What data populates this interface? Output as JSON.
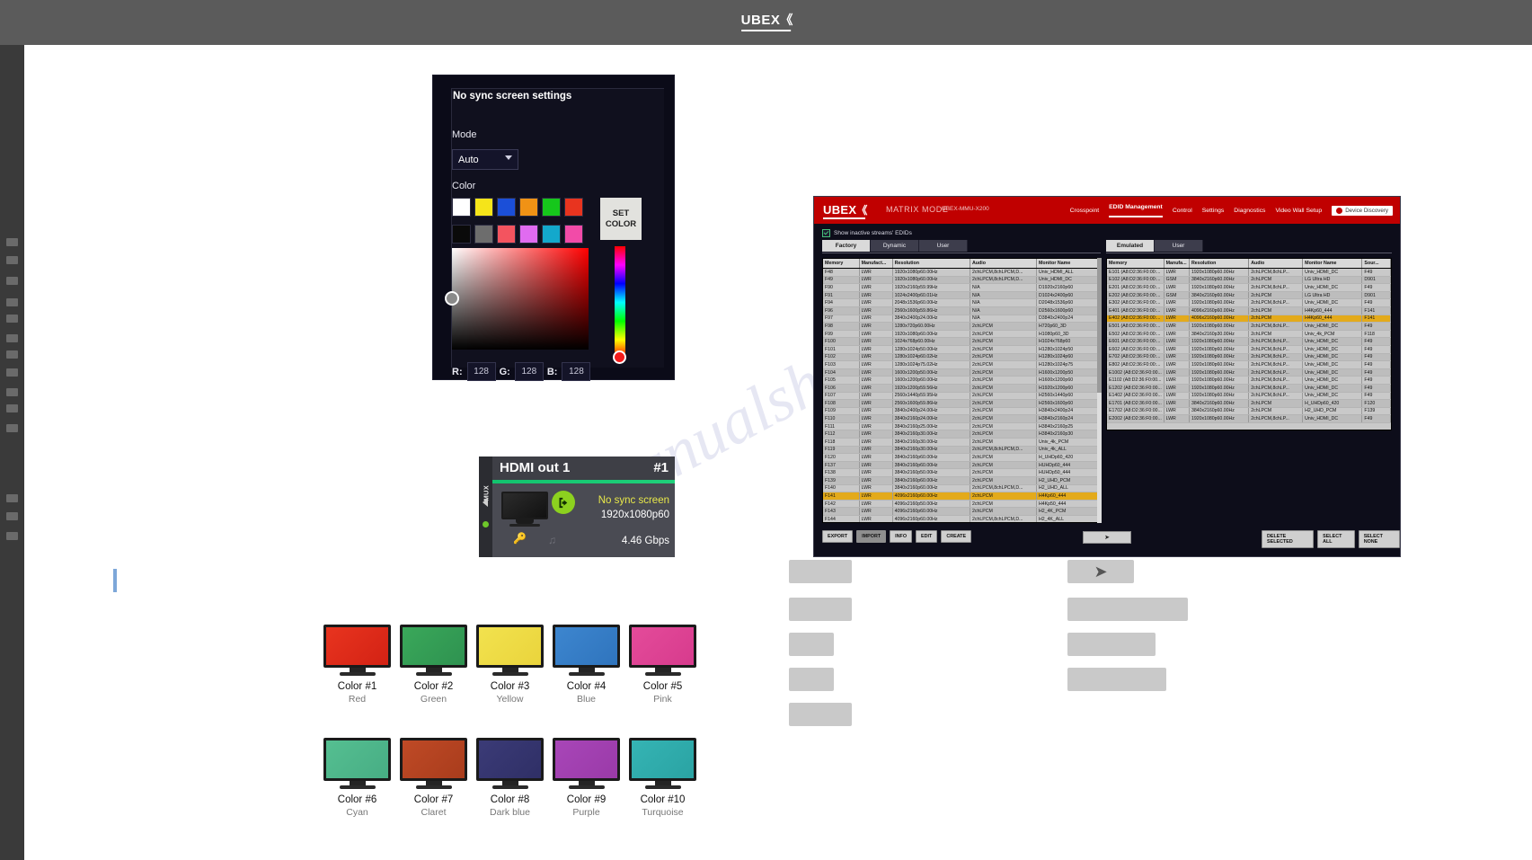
{
  "window": {
    "app_name": "UBEX",
    "logo_mark": "《"
  },
  "no_sync_dialog": {
    "title": "No sync screen settings",
    "mode_label": "Mode",
    "mode_value": "Auto",
    "color_label": "Color",
    "set_color_button": "SET COLOR",
    "swatches_row1": [
      "#ffffff",
      "#f5e41a",
      "#1b4fd8",
      "#f09215",
      "#16c71b",
      "#e8341f"
    ],
    "swatches_row2": [
      "#0a0a0a",
      "#6d6d6d",
      "#f3545f",
      "#e06bf0",
      "#13a8cc",
      "#f24ba8"
    ],
    "rgb": {
      "r_label": "R:",
      "r_value": "128",
      "g_label": "G:",
      "g_value": "128",
      "b_label": "B:",
      "b_value": "128"
    }
  },
  "hdmi_card": {
    "mux_label": "MUX",
    "title": "HDMI out 1",
    "number": "#1",
    "status": "No sync screen",
    "resolution": "1920x1080p60",
    "bitrate": "4.46 Gbps",
    "key_icon": "key-icon",
    "note_icon": "music-note-icon"
  },
  "color_monitors": [
    {
      "name": "Color #1",
      "label": "Red",
      "color": "#e8341f",
      "color2": "#d32214"
    },
    {
      "name": "Color #2",
      "label": "Green",
      "color": "#3aa85a",
      "color2": "#2e9250"
    },
    {
      "name": "Color #3",
      "label": "Yellow",
      "color": "#f2e24e",
      "color2": "#ead43c"
    },
    {
      "name": "Color #4",
      "label": "Blue",
      "color": "#3d86cf",
      "color2": "#2f74bd"
    },
    {
      "name": "Color #5",
      "label": "Pink",
      "color": "#e44b9a",
      "color2": "#d73b8d"
    },
    {
      "name": "Color #6",
      "label": "Cyan",
      "color": "#55bf91",
      "color2": "#47ad84"
    },
    {
      "name": "Color #7",
      "label": "Claret",
      "color": "#bf4a26",
      "color2": "#a93c1c"
    },
    {
      "name": "Color #8",
      "label": "Dark blue",
      "color": "#3b3b77",
      "color2": "#2f2f66"
    },
    {
      "name": "Color #9",
      "label": "Purple",
      "color": "#a846b8",
      "color2": "#9a3aa8"
    },
    {
      "name": "Color #10",
      "label": "Turquoise",
      "color": "#35b4b4",
      "color2": "#2aa3a3"
    }
  ],
  "ubex_app": {
    "brand": "UBEX",
    "mode": "MATRIX MODE",
    "device": "UBEX-MMU-X200",
    "nav": [
      "Crosspoint",
      "EDID Management",
      "Control",
      "Settings",
      "Diagnostics",
      "Video Wall Setup"
    ],
    "nav_active": "EDID Management",
    "device_discovery_button": "Device Discovery",
    "show_inactive_label": "Show inactive streams' EDIDs",
    "left_tabs": [
      "Factory",
      "Dynamic",
      "User"
    ],
    "left_tab_active": "Factory",
    "right_tabs": [
      "Emulated",
      "User"
    ],
    "right_tab_active": "Emulated",
    "left_columns": [
      "Memory",
      "Manufact...",
      "Resolution",
      "Audio",
      "Monitor Name"
    ],
    "right_columns": [
      "Memory",
      "Manufa...",
      "Resolution",
      "Audio",
      "Monitor Name",
      "Sour..."
    ],
    "left_rows": [
      [
        "F48",
        "LWR",
        "1920x1080p60.00Hz",
        "2chLPCM,8chLPCM,D...",
        "Univ_HDMI_ALL"
      ],
      [
        "F49",
        "LWR",
        "1920x1080p60.00Hz",
        "2chLPCM,8chLPCM,D...",
        "Univ_HDMI_DC"
      ],
      [
        "F90",
        "LWR",
        "1920x2160p59.99Hz",
        "N/A",
        "D1920x2160p60"
      ],
      [
        "F91",
        "LWR",
        "1024x2400p60.01Hz",
        "N/A",
        "D1024x2400p60"
      ],
      [
        "F94",
        "LWR",
        "2048x1536p60.00Hz",
        "N/A",
        "D2048x1536p60"
      ],
      [
        "F96",
        "LWR",
        "2560x1600p59.86Hz",
        "N/A",
        "D2560x1600p60"
      ],
      [
        "F97",
        "LWR",
        "3840x2400p24.00Hz",
        "N/A",
        "D3840x2400p24"
      ],
      [
        "F98",
        "LWR",
        "1280x720p60.00Hz",
        "2chLPCM",
        "H720p60_3D"
      ],
      [
        "F99",
        "LWR",
        "1920x1080p60.00Hz",
        "2chLPCM",
        "H1080p60_3D"
      ],
      [
        "F100",
        "LWR",
        "1024x768p60.00Hz",
        "2chLPCM",
        "H1024x768p60"
      ],
      [
        "F101",
        "LWR",
        "1280x1024p50.00Hz",
        "2chLPCM",
        "H1280x1024p50"
      ],
      [
        "F102",
        "LWR",
        "1280x1024p60.02Hz",
        "2chLPCM",
        "H1280x1024p60"
      ],
      [
        "F103",
        "LWR",
        "1280x1024p75.02Hz",
        "2chLPCM",
        "H1280x1024p75"
      ],
      [
        "F104",
        "LWR",
        "1600x1200p50.00Hz",
        "2chLPCM",
        "H1600x1200p50"
      ],
      [
        "F105",
        "LWR",
        "1600x1200p60.00Hz",
        "2chLPCM",
        "H1600x1200p60"
      ],
      [
        "F106",
        "LWR",
        "1920x1200p59.56Hz",
        "2chLPCM",
        "H1920x1200p60"
      ],
      [
        "F107",
        "LWR",
        "2560x1440p59.95Hz",
        "2chLPCM",
        "H2560x1440p60"
      ],
      [
        "F108",
        "LWR",
        "2560x1600p59.86Hz",
        "2chLPCM",
        "H2560x1600p60"
      ],
      [
        "F109",
        "LWR",
        "3840x2400p24.00Hz",
        "2chLPCM",
        "H3840x2400p24"
      ],
      [
        "F110",
        "LWR",
        "3840x2160p24.00Hz",
        "2chLPCM",
        "H3840x2160p24"
      ],
      [
        "F111",
        "LWR",
        "3840x2160p25.00Hz",
        "2chLPCM",
        "H3840x2160p25"
      ],
      [
        "F112",
        "LWR",
        "3840x2160p30.00Hz",
        "2chLPCM",
        "H3840x2160p30"
      ],
      [
        "F118",
        "LWR",
        "3840x2160p30.00Hz",
        "2chLPCM",
        "Univ_4k_PCM"
      ],
      [
        "F119",
        "LWR",
        "3840x2160p30.00Hz",
        "2chLPCM,8chLPCM,D...",
        "Univ_4k_ALL"
      ],
      [
        "F120",
        "LWR",
        "3840x2160p60.00Hz",
        "2chLPCM",
        "H_UHDp60_420"
      ],
      [
        "F137",
        "LWR",
        "3840x2160p60.00Hz",
        "2chLPCM",
        "HUHDp60_444"
      ],
      [
        "F138",
        "LWR",
        "3840x2160p50.00Hz",
        "2chLPCM",
        "HUHDp50_444"
      ],
      [
        "F139",
        "LWR",
        "3840x2160p60.00Hz",
        "2chLPCM",
        "H2_UHD_PCM"
      ],
      [
        "F140",
        "LWR",
        "3840x2160p60.00Hz",
        "2chLPCM,8chLPCM,D...",
        "H2_UHD_ALL"
      ],
      [
        "F141",
        "LWR",
        "4096x2160p60.00Hz",
        "2chLPCM",
        "H4Kp60_444"
      ],
      [
        "F142",
        "LWR",
        "4096x2160p50.00Hz",
        "2chLPCM",
        "H4Kp50_444"
      ],
      [
        "F143",
        "LWR",
        "4096x2160p60.00Hz",
        "2chLPCM",
        "H2_4K_PCM"
      ],
      [
        "F144",
        "LWR",
        "4096x2160p60.00Hz",
        "2chLPCM,8chLPCM,D...",
        "H2_4K_ALL"
      ]
    ],
    "left_highlight_row": "F141",
    "right_rows": [
      [
        "E101 (A8:D2:36:F0:00:...",
        "LWR",
        "1920x1080p60.00Hz",
        "2chLPCM,8chLP...",
        "Univ_HDMI_DC",
        "F49"
      ],
      [
        "E102 (A8:D2:36:F0:00:...",
        "GSM",
        "3840x2160p60.00Hz",
        "2chLPCM",
        "LG Ultra HD",
        "D901"
      ],
      [
        "E201 (A8:D2:36:F0:00:...",
        "LWR",
        "1920x1080p60.00Hz",
        "2chLPCM,8chLP...",
        "Univ_HDMI_DC",
        "F49"
      ],
      [
        "E202 (A8:D2:36:F0:00:...",
        "GSM",
        "3840x2160p60.00Hz",
        "2chLPCM",
        "LG Ultra HD",
        "D901"
      ],
      [
        "E302 (A8:D2:36:F0:00:...",
        "LWR",
        "1920x1080p60.00Hz",
        "2chLPCM,8chLP...",
        "Univ_HDMI_DC",
        "F49"
      ],
      [
        "E401 (A8:D2:36:F0:00:...",
        "LWR",
        "4096x2160p60.00Hz",
        "2chLPCM",
        "H4Kp60_444",
        "F141"
      ],
      [
        "E402 (A8:D2:36:F0:00:...",
        "LWR",
        "4096x2160p60.00Hz",
        "2chLPCM",
        "H4Kp60_444",
        "F141"
      ],
      [
        "E501 (A8:D2:36:F0:00:...",
        "LWR",
        "1920x1080p60.00Hz",
        "2chLPCM,8chLP...",
        "Univ_HDMI_DC",
        "F49"
      ],
      [
        "E502 (A8:D2:36:F0:00:...",
        "LWR",
        "3840x2160p30.00Hz",
        "2chLPCM",
        "Univ_4k_PCM",
        "F118"
      ],
      [
        "E601 (A8:D2:36:F0:00:...",
        "LWR",
        "1920x1080p60.00Hz",
        "2chLPCM,8chLP...",
        "Univ_HDMI_DC",
        "F49"
      ],
      [
        "E602 (A8:D2:36:F0:00:...",
        "LWR",
        "1920x1080p60.00Hz",
        "2chLPCM,8chLP...",
        "Univ_HDMI_DC",
        "F49"
      ],
      [
        "E702 (A8:D2:36:F0:00:...",
        "LWR",
        "1920x1080p60.00Hz",
        "2chLPCM,8chLP...",
        "Univ_HDMI_DC",
        "F49"
      ],
      [
        "E802 (A8:D2:36:F0:00:...",
        "LWR",
        "1920x1080p60.00Hz",
        "2chLPCM,8chLP...",
        "Univ_HDMI_DC",
        "F49"
      ],
      [
        "E1002 (A8:D2:36:F0:00...",
        "LWR",
        "1920x1080p60.00Hz",
        "2chLPCM,8chLP...",
        "Univ_HDMI_DC",
        "F49"
      ],
      [
        "E1102 (A8:D2:36:F0:00...",
        "LWR",
        "1920x1080p60.00Hz",
        "2chLPCM,8chLP...",
        "Univ_HDMI_DC",
        "F49"
      ],
      [
        "E1202 (A8:D2:36:F0:00...",
        "LWR",
        "1920x1080p60.00Hz",
        "2chLPCM,8chLP...",
        "Univ_HDMI_DC",
        "F49"
      ],
      [
        "E1402 (A8:D2:36:F0:00...",
        "LWR",
        "1920x1080p60.00Hz",
        "2chLPCM,8chLP...",
        "Univ_HDMI_DC",
        "F49"
      ],
      [
        "E1701 (A8:D2:36:F0:00...",
        "LWR",
        "3840x2160p60.00Hz",
        "2chLPCM",
        "H_UHDp60_420",
        "F120"
      ],
      [
        "E1702 (A8:D2:36:F0:00...",
        "LWR",
        "3840x2160p60.00Hz",
        "2chLPCM",
        "H2_UHD_PCM",
        "F139"
      ],
      [
        "E2002 (A8:D2:36:F0:00...",
        "LWR",
        "1920x1080p60.00Hz",
        "2chLPCM,8chLP...",
        "Univ_HDMI_DC",
        "F49"
      ]
    ],
    "right_highlight_row": "E402 (A8:D2:36:F0:00:...",
    "left_buttons": [
      "EXPORT",
      "IMPORT",
      "INFO",
      "EDIT",
      "CREATE"
    ],
    "right_buttons": [
      "DELETE SELECTED",
      "SELECT ALL",
      "SELECT NONE"
    ],
    "transfer_button": "➤"
  },
  "accents": {
    "brand_red": "#c00000",
    "highlight_yellow": "#e3aa1b",
    "green": "#12c36e",
    "lime": "#8cd11f"
  }
}
